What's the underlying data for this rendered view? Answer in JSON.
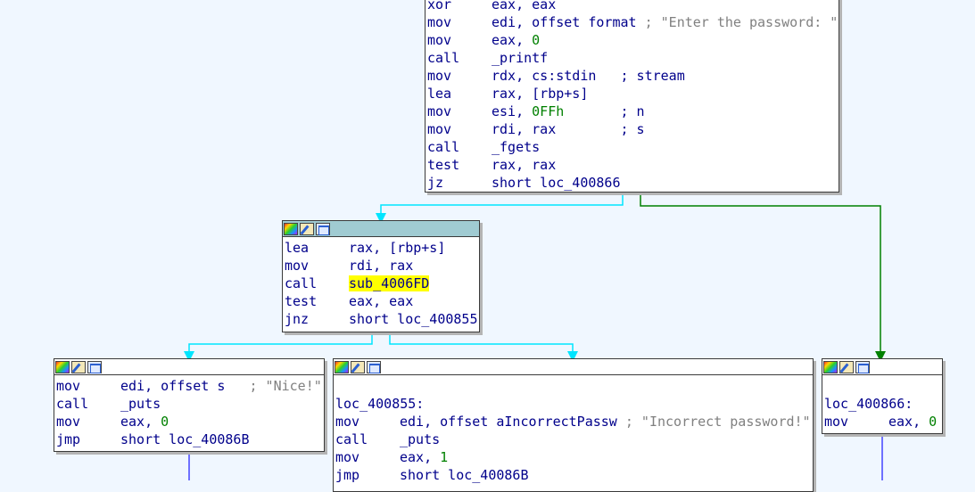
{
  "colors": {
    "background": "#f0f7ff",
    "instruction_text": "#00008b",
    "number_text": "#008000",
    "comment_text": "#808080",
    "highlight": "#ffff00",
    "selected_header": "#a0cbd2",
    "edge_normal": "#00e5ff",
    "edge_taken": "#008000",
    "edge_fallthrough": "#4444ff"
  },
  "nodes": {
    "top": {
      "rows": [
        {
          "mnem": "xor",
          "op": "eax, eax",
          "num": "",
          "cmt": ""
        },
        {
          "mnem": "mov",
          "op": "edi, offset format ",
          "num": "",
          "cmt": "; \"Enter the password: \""
        },
        {
          "mnem": "mov",
          "op": "eax, ",
          "num": "0",
          "cmt": ""
        },
        {
          "mnem": "call",
          "op": "_printf",
          "num": "",
          "cmt": ""
        },
        {
          "mnem": "mov",
          "op": "rdx, cs:stdin   ",
          "num": "",
          "cmt": "; stream"
        },
        {
          "mnem": "lea",
          "op": "rax, [rbp+s]",
          "num": "",
          "cmt": ""
        },
        {
          "mnem": "mov",
          "op": "esi, ",
          "num": "0FFh",
          "cmt": "       ; n"
        },
        {
          "mnem": "mov",
          "op": "rdi, rax        ",
          "num": "",
          "cmt": "; s"
        },
        {
          "mnem": "call",
          "op": "_fgets",
          "num": "",
          "cmt": ""
        },
        {
          "mnem": "test",
          "op": "rax, rax",
          "num": "",
          "cmt": ""
        },
        {
          "mnem": "jz",
          "op": "short loc_400866",
          "num": "",
          "cmt": ""
        }
      ]
    },
    "check": {
      "rows": [
        {
          "mnem": "lea",
          "op": "rax, [rbp+s]"
        },
        {
          "mnem": "mov",
          "op": "rdi, rax"
        },
        {
          "mnem": "call",
          "op": "sub_4006FD"
        },
        {
          "mnem": "test",
          "op": "eax, eax"
        },
        {
          "mnem": "jnz",
          "op": "short loc_400855"
        }
      ]
    },
    "nice": {
      "rows": [
        {
          "mnem": "mov",
          "op": "edi, offset s   ",
          "num": "",
          "cmt": "; \"Nice!\""
        },
        {
          "mnem": "call",
          "op": "_puts",
          "num": "",
          "cmt": ""
        },
        {
          "mnem": "mov",
          "op": "eax, ",
          "num": "0",
          "cmt": ""
        },
        {
          "mnem": "jmp",
          "op": "short loc_40086B",
          "num": "",
          "cmt": ""
        }
      ]
    },
    "incorrect": {
      "label": "loc_400855:",
      "rows": [
        {
          "mnem": "mov",
          "op": "edi, offset aIncorrectPassw ",
          "num": "",
          "cmt": "; \"Incorrect password!\""
        },
        {
          "mnem": "call",
          "op": "_puts",
          "num": "",
          "cmt": ""
        },
        {
          "mnem": "mov",
          "op": "eax, ",
          "num": "1",
          "cmt": ""
        },
        {
          "mnem": "jmp",
          "op": "short loc_40086B",
          "num": "",
          "cmt": ""
        }
      ]
    },
    "fail": {
      "label": "loc_400866:",
      "rows": [
        {
          "mnem": "mov",
          "op": "eax, ",
          "num": "0",
          "cmt": ""
        }
      ]
    }
  }
}
